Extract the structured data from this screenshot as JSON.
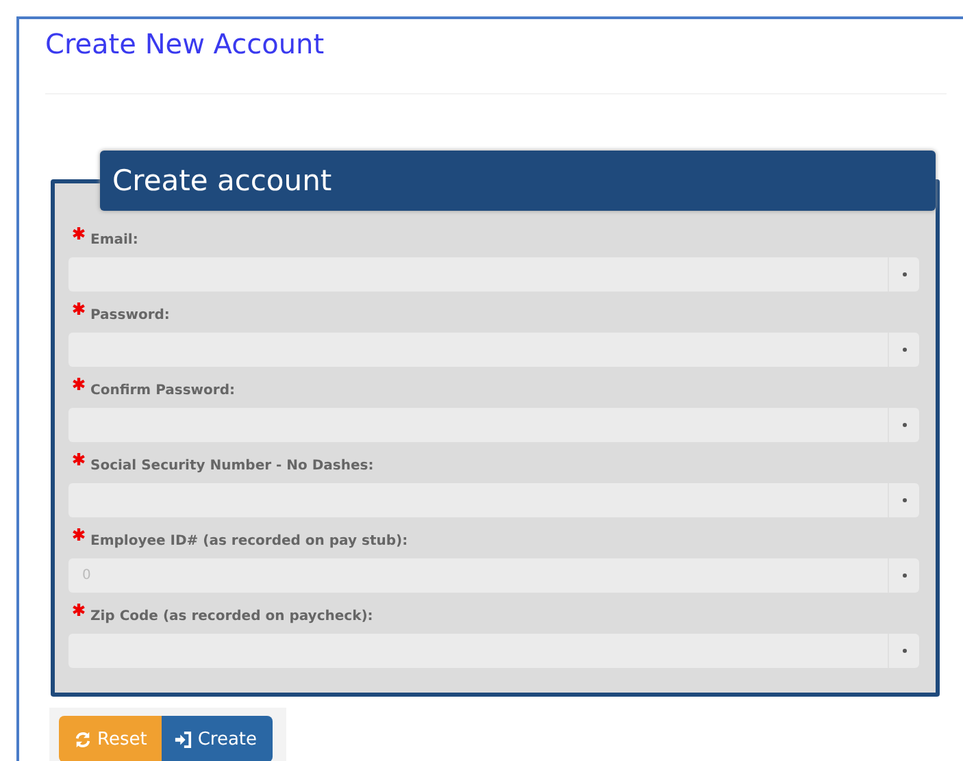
{
  "page": {
    "title": "Create New Account"
  },
  "form": {
    "legend": "Create account",
    "fields": [
      {
        "label": "Email:",
        "required": true
      },
      {
        "label": "Password:",
        "required": true
      },
      {
        "label": "Confirm Password:",
        "required": true
      },
      {
        "label": "Social Security Number - No Dashes:",
        "required": true
      },
      {
        "label": "Employee ID# (as recorded on pay stub):",
        "required": true,
        "placeholder": "0"
      },
      {
        "label": "Zip Code (as recorded on paycheck):",
        "required": true
      }
    ]
  },
  "buttons": [
    {
      "label": "Reset",
      "kind": "reset"
    },
    {
      "label": "Create",
      "kind": "create"
    }
  ]
}
